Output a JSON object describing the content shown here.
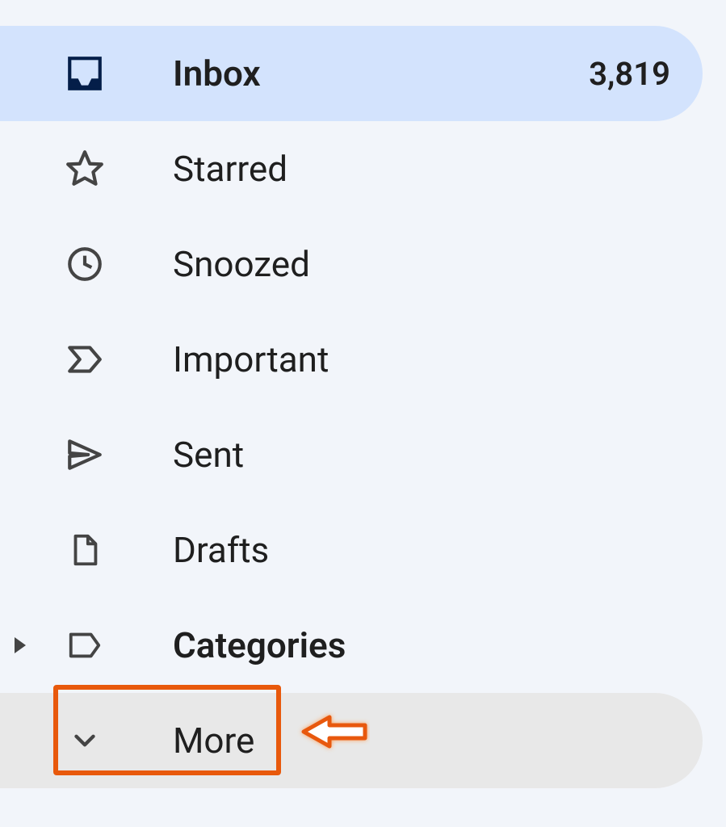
{
  "sidebar": {
    "items": [
      {
        "label": "Inbox",
        "count": "3,819",
        "icon": "inbox-icon",
        "active": true,
        "bold": true
      },
      {
        "label": "Starred",
        "icon": "star-icon"
      },
      {
        "label": "Snoozed",
        "icon": "clock-icon"
      },
      {
        "label": "Important",
        "icon": "important-icon"
      },
      {
        "label": "Sent",
        "icon": "send-icon"
      },
      {
        "label": "Drafts",
        "icon": "file-icon"
      },
      {
        "label": "Categories",
        "icon": "label-icon",
        "bold": true,
        "expandable": true
      },
      {
        "label": "More",
        "icon": "chevron-down-icon",
        "hover": true
      }
    ]
  },
  "annotation": {
    "highlight_target": "More",
    "arrow_color": "#e8590c"
  }
}
